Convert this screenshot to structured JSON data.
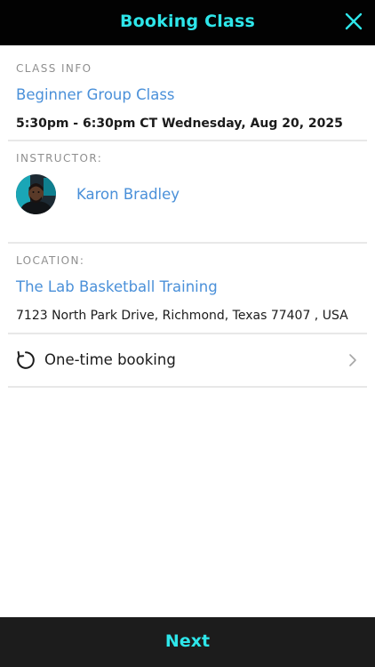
{
  "header": {
    "title": "Booking Class",
    "close_icon": "close-icon",
    "accent_color": "#2ee6ea"
  },
  "class_info": {
    "label": "CLASS INFO",
    "name": "Beginner Group Class",
    "schedule": "5:30pm - 6:30pm CT Wednesday, Aug 20, 2025"
  },
  "instructor": {
    "label": "INSTRUCTOR:",
    "name": "Karon Bradley",
    "avatar_icon": "avatar"
  },
  "location": {
    "label": "LOCATION:",
    "name": "The Lab Basketball Training",
    "address": "7123 North Park Drive, Richmond, Texas 77407 , USA"
  },
  "booking": {
    "label": "One-time booking",
    "icon": "refresh-icon",
    "chevron_icon": "chevron-right-icon"
  },
  "footer": {
    "next_label": "Next"
  },
  "colors": {
    "link": "#4a90d9",
    "header_bg": "#020202",
    "footer_bg": "#1c1c1c"
  }
}
